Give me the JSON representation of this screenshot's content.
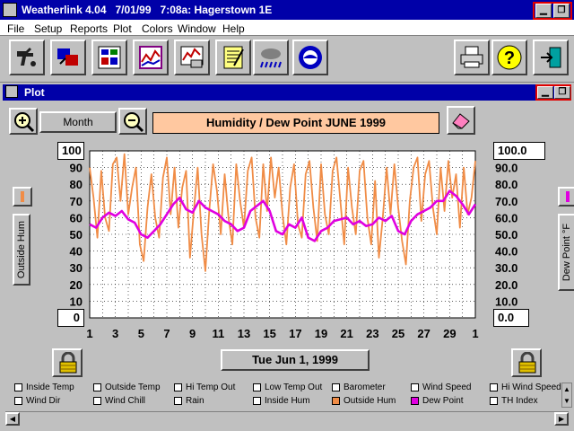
{
  "app": {
    "title": "Weatherlink 4.04   7/01/99   7:08a: Hagerstown 1E"
  },
  "menu": [
    "File",
    "Setup",
    "Reports",
    "Plot",
    "Colors",
    "Window",
    "Help"
  ],
  "toolbar_icons": [
    "station-icon",
    "download-icon",
    "summary-icon",
    "plot-icon",
    "strip-chart-icon",
    "notebook-icon",
    "weather-icon",
    "noaa-icon",
    "print-icon",
    "help-icon",
    "exit-icon"
  ],
  "plot_window": {
    "title": "Plot",
    "range_button": "Month",
    "chart_title": "Humidity  /  Dew Point   JUNE 1999",
    "left_top_value": "100",
    "left_bottom_value": "0",
    "right_top_value": "100.0",
    "right_bottom_value": "0.0",
    "left_axis_label": "Outside Hum",
    "right_axis_label": "Dew Point °F",
    "date_button": "Tue Jun 1, 1999"
  },
  "legend": [
    {
      "label": "Inside Temp",
      "checked": false,
      "color": "#ffffff"
    },
    {
      "label": "Outside Temp",
      "checked": false,
      "color": "#ffffff"
    },
    {
      "label": "Hi Temp Out",
      "checked": false,
      "color": "#ffffff"
    },
    {
      "label": "Low Temp Out",
      "checked": false,
      "color": "#ffffff"
    },
    {
      "label": "Barometer",
      "checked": false,
      "color": "#ffffff"
    },
    {
      "label": "Wind Speed",
      "checked": false,
      "color": "#ffffff"
    },
    {
      "label": "Hi Wind Speed",
      "checked": false,
      "color": "#ffffff"
    },
    {
      "label": "Wind Dir",
      "checked": false,
      "color": "#ffffff"
    },
    {
      "label": "Wind Chill",
      "checked": false,
      "color": "#ffffff"
    },
    {
      "label": "Rain",
      "checked": false,
      "color": "#ffffff"
    },
    {
      "label": "Inside Hum",
      "checked": false,
      "color": "#ffffff"
    },
    {
      "label": "Outside Hum",
      "checked": true,
      "color": "#f08c46"
    },
    {
      "label": "Dew Point",
      "checked": true,
      "color": "#e000e0"
    },
    {
      "label": "TH Index",
      "checked": false,
      "color": "#ffffff"
    }
  ],
  "chart_data": {
    "type": "line",
    "x_tick_labels": [
      "1",
      "3",
      "5",
      "7",
      "9",
      "11",
      "13",
      "15",
      "17",
      "19",
      "21",
      "23",
      "25",
      "27",
      "29",
      "1"
    ],
    "y_left_ticks": [
      "90",
      "80",
      "70",
      "60",
      "50",
      "40",
      "30",
      "20",
      "10"
    ],
    "y_right_ticks": [
      "90.0",
      "80.0",
      "70.0",
      "60.0",
      "50.0",
      "40.0",
      "30.0",
      "20.0",
      "10.0"
    ],
    "xlim": [
      1,
      31
    ],
    "ylim": [
      0,
      100
    ],
    "grid": true,
    "series": [
      {
        "color": "#f08c46",
        "axis": "left",
        "x": [
          1.0,
          1.3,
          1.6,
          1.9,
          2.2,
          2.5,
          2.8,
          3.1,
          3.4,
          3.7,
          4.0,
          4.3,
          4.6,
          4.9,
          5.2,
          5.5,
          5.8,
          6.1,
          6.4,
          6.7,
          7.0,
          7.3,
          7.6,
          7.9,
          8.2,
          8.5,
          8.8,
          9.1,
          9.4,
          9.7,
          10.0,
          10.3,
          10.6,
          10.9,
          11.2,
          11.5,
          11.8,
          12.1,
          12.4,
          12.7,
          13.0,
          13.3,
          13.6,
          13.9,
          14.2,
          14.5,
          14.8,
          15.1,
          15.4,
          15.7,
          16.0,
          16.3,
          16.6,
          16.9,
          17.2,
          17.5,
          17.8,
          18.1,
          18.4,
          18.7,
          19.0,
          19.3,
          19.6,
          19.9,
          20.2,
          20.5,
          20.8,
          21.1,
          21.4,
          21.7,
          22.0,
          22.3,
          22.6,
          22.9,
          23.2,
          23.5,
          23.8,
          24.1,
          24.4,
          24.7,
          25.0,
          25.3,
          25.6,
          25.9,
          26.2,
          26.5,
          26.8,
          27.1,
          27.4,
          27.7,
          28.0,
          28.3,
          28.6,
          28.9,
          29.2,
          29.5,
          29.8,
          30.1,
          30.4,
          30.7,
          31.0
        ],
        "values": [
          90,
          72,
          48,
          88,
          60,
          52,
          92,
          96,
          70,
          98,
          62,
          78,
          90,
          44,
          34,
          66,
          86,
          60,
          48,
          84,
          96,
          62,
          90,
          54,
          78,
          88,
          36,
          64,
          90,
          50,
          28,
          64,
          92,
          76,
          50,
          86,
          60,
          44,
          92,
          70,
          54,
          88,
          96,
          60,
          48,
          92,
          64,
          96,
          72,
          90,
          62,
          44,
          78,
          92,
          56,
          48,
          86,
          94,
          66,
          46,
          92,
          62,
          50,
          88,
          96,
          70,
          44,
          90,
          66,
          50,
          88,
          94,
          60,
          44,
          82,
          36,
          60,
          90,
          62,
          92,
          66,
          46,
          32,
          70,
          90,
          96,
          58,
          86,
          94,
          66,
          50,
          90,
          64,
          94,
          72,
          86,
          54,
          90,
          62,
          72,
          94
        ],
        "name": "Outside Hum"
      },
      {
        "color": "#e000e0",
        "axis": "right",
        "x": [
          1.0,
          1.5,
          2.0,
          2.5,
          3.0,
          3.5,
          4.0,
          4.5,
          5.0,
          5.5,
          6.0,
          6.5,
          7.0,
          7.5,
          8.0,
          8.5,
          9.0,
          9.5,
          10.0,
          10.5,
          11.0,
          11.5,
          12.0,
          12.5,
          13.0,
          13.5,
          14.0,
          14.5,
          15.0,
          15.5,
          16.0,
          16.5,
          17.0,
          17.5,
          18.0,
          18.5,
          19.0,
          19.5,
          20.0,
          20.5,
          21.0,
          21.5,
          22.0,
          22.5,
          23.0,
          23.5,
          24.0,
          24.5,
          25.0,
          25.5,
          26.0,
          26.5,
          27.0,
          27.5,
          28.0,
          28.5,
          29.0,
          29.5,
          30.0,
          30.5,
          31.0
        ],
        "values": [
          56,
          54,
          60,
          63,
          61,
          64,
          59,
          57,
          50,
          48,
          52,
          56,
          62,
          68,
          72,
          65,
          63,
          70,
          66,
          64,
          62,
          58,
          56,
          52,
          54,
          64,
          67,
          70,
          64,
          52,
          50,
          56,
          54,
          60,
          48,
          46,
          52,
          54,
          58,
          59,
          60,
          56,
          58,
          55,
          56,
          60,
          58,
          61,
          52,
          50,
          58,
          62,
          64,
          66,
          70,
          70,
          76,
          73,
          68,
          62,
          68
        ],
        "name": "Dew Point"
      }
    ]
  }
}
